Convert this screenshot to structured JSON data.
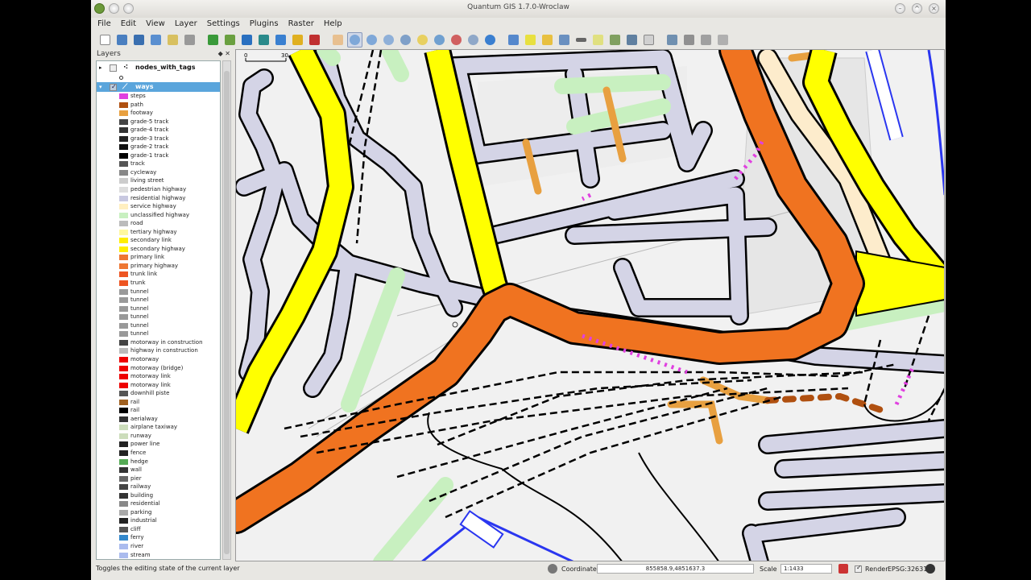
{
  "window": {
    "title": "Quantum GIS 1.7.0-Wroclaw"
  },
  "menu": [
    "File",
    "Edit",
    "View",
    "Layer",
    "Settings",
    "Plugins",
    "Raster",
    "Help"
  ],
  "layers_panel": {
    "title": "Layers",
    "layers": [
      {
        "name": "nodes_with_tags",
        "checked": false
      },
      {
        "name": "ways",
        "checked": true
      }
    ],
    "legend": [
      {
        "label": "steps",
        "color": "#e040e0"
      },
      {
        "label": "path",
        "color": "#b05010"
      },
      {
        "label": "footway",
        "color": "#e8a040"
      },
      {
        "label": "grade-5 track",
        "color": "#444444"
      },
      {
        "label": "grade-4 track",
        "color": "#333333"
      },
      {
        "label": "grade-3 track",
        "color": "#222222"
      },
      {
        "label": "grade-2 track",
        "color": "#111111"
      },
      {
        "label": "grade-1 track",
        "color": "#000000"
      },
      {
        "label": "track",
        "color": "#555555"
      },
      {
        "label": "cycleway",
        "color": "#888888"
      },
      {
        "label": "living street",
        "color": "#cccccc"
      },
      {
        "label": "pedestrian highway",
        "color": "#dddddd"
      },
      {
        "label": "residential highway",
        "color": "#c8c8e0"
      },
      {
        "label": "service highway",
        "color": "#ffefc0"
      },
      {
        "label": "unclassified highway",
        "color": "#c8f0c0"
      },
      {
        "label": "road",
        "color": "#bbbbbb"
      },
      {
        "label": "tertiary highway",
        "color": "#fff8a0"
      },
      {
        "label": "secondary link",
        "color": "#ffee00"
      },
      {
        "label": "secondary highway",
        "color": "#ffee00"
      },
      {
        "label": "primary link",
        "color": "#ee7733"
      },
      {
        "label": "primary highway",
        "color": "#ee7733"
      },
      {
        "label": "trunk link",
        "color": "#ee5522"
      },
      {
        "label": "trunk",
        "color": "#ee5522"
      },
      {
        "label": "tunnel",
        "color": "#999999"
      },
      {
        "label": "tunnel",
        "color": "#999999"
      },
      {
        "label": "tunnel",
        "color": "#999999"
      },
      {
        "label": "tunnel",
        "color": "#999999"
      },
      {
        "label": "tunnel",
        "color": "#999999"
      },
      {
        "label": "tunnel",
        "color": "#999999"
      },
      {
        "label": "motorway in construction",
        "color": "#444444"
      },
      {
        "label": "highway in construction",
        "color": "#bbbbbb"
      },
      {
        "label": "motorway",
        "color": "#ee0000"
      },
      {
        "label": "motorway (bridge)",
        "color": "#ee0000"
      },
      {
        "label": "motorway link",
        "color": "#ee0000"
      },
      {
        "label": "motorway link",
        "color": "#ee0000"
      },
      {
        "label": "downhill piste",
        "color": "#555555"
      },
      {
        "label": "rail",
        "color": "#a06020"
      },
      {
        "label": "rail",
        "color": "#000000"
      },
      {
        "label": "aerialway",
        "color": "#333333"
      },
      {
        "label": "airplane taxiway",
        "color": "#ccddbb"
      },
      {
        "label": "runway",
        "color": "#ccddbb"
      },
      {
        "label": "power line",
        "color": "#222222"
      },
      {
        "label": "fence",
        "color": "#222222"
      },
      {
        "label": "hedge",
        "color": "#55aa55"
      },
      {
        "label": "wall",
        "color": "#333333"
      },
      {
        "label": "pier",
        "color": "#666666"
      },
      {
        "label": "railway",
        "color": "#444444"
      },
      {
        "label": "building",
        "color": "#333333"
      },
      {
        "label": "residential",
        "color": "#888888"
      },
      {
        "label": "parking",
        "color": "#aaaaaa"
      },
      {
        "label": "industrial",
        "color": "#222222"
      },
      {
        "label": "cliff",
        "color": "#555555"
      },
      {
        "label": "ferry",
        "color": "#3388cc"
      },
      {
        "label": "river",
        "color": "#aabbee"
      },
      {
        "label": "stream",
        "color": "#aabbee"
      }
    ]
  },
  "map": {
    "scalebar_labels": [
      "0",
      "30"
    ]
  },
  "status": {
    "message": "Toggles the editing state of the current layer",
    "coordinate_label": "Coordinate:",
    "coordinate_value": "855858.9,4851637.3",
    "scale_label": "Scale",
    "scale_value": "1:1433",
    "render_label": "Render",
    "crs": "EPSG:32631"
  },
  "colors": {
    "trunk": "#f07320",
    "secondary": "#ffff00",
    "residential": "#d4d4e6",
    "unclassified": "#c8f0c0",
    "service": "#fdeccc",
    "footway": "#e8a040",
    "steps": "#e040e0",
    "path": "#b05010",
    "river": "#2a36f0"
  }
}
